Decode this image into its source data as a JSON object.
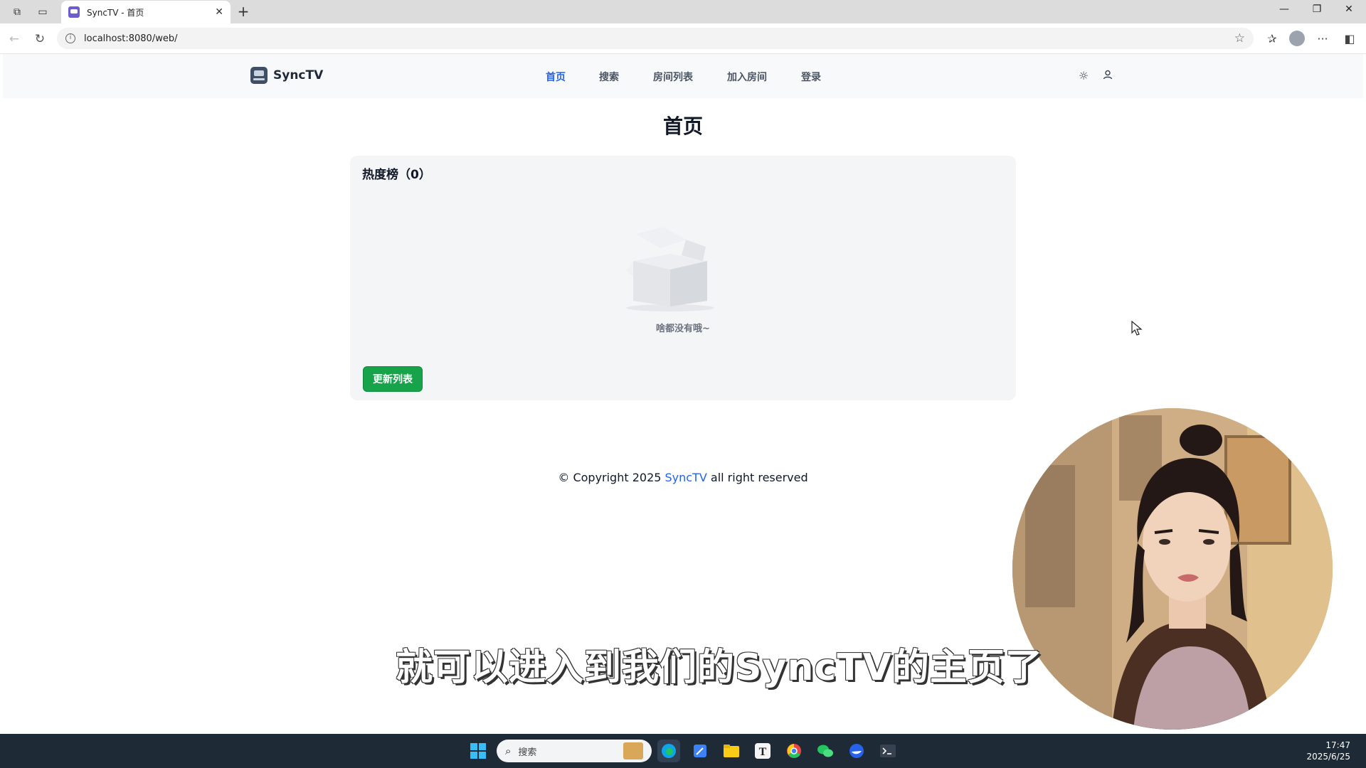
{
  "browser": {
    "tab_title": "SyncTV - 首页",
    "url": "localhost:8080/web/"
  },
  "site": {
    "brand": "SyncTV",
    "nav": [
      "首页",
      "搜索",
      "房间列表",
      "加入房间",
      "登录"
    ],
    "active_nav": "首页"
  },
  "page": {
    "title": "首页",
    "card_title": "热度榜（0）",
    "empty_text": "啥都没有哦~",
    "refresh_button": "更新列表",
    "footer_prefix": "© Copyright 2025 ",
    "footer_link": "SyncTV",
    "footer_suffix": " all right reserved"
  },
  "video_overlay": {
    "subtitle": "就可以进入到我们的SyncTV的主页了"
  },
  "taskbar": {
    "search_placeholder": "搜索",
    "time": "17:47",
    "date": "2025/6/25"
  },
  "colors": {
    "accent": "#2563eb",
    "button_green": "#16a34a",
    "taskbar": "#1e2a36"
  }
}
